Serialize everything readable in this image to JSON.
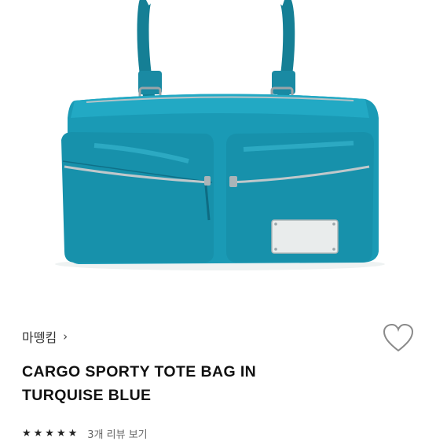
{
  "product": {
    "brand": "마뗑킴",
    "brand_chevron": "›",
    "title_line1": "CARGO SPORTY TOTE BAG IN",
    "title_line2": "TURQUISE BLUE",
    "stars": "★★★★★",
    "review_link": "3개 리뷰 보기",
    "color": "#1496b0"
  },
  "icons": {
    "wishlist": "heart-outline-icon",
    "brand_link": "chevron-right-icon"
  }
}
